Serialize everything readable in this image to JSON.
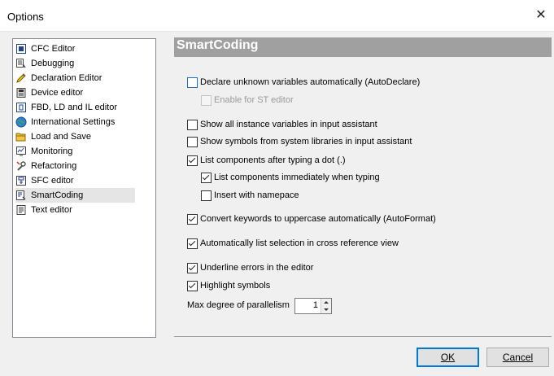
{
  "window": {
    "title": "Options"
  },
  "sidebar": {
    "items": [
      {
        "label": "CFC Editor",
        "icon": "cfc-editor-icon"
      },
      {
        "label": "Debugging",
        "icon": "debugging-icon"
      },
      {
        "label": "Declaration Editor",
        "icon": "declaration-editor-icon"
      },
      {
        "label": "Device editor",
        "icon": "device-editor-icon"
      },
      {
        "label": "FBD, LD and IL editor",
        "icon": "fbd-ld-il-editor-icon"
      },
      {
        "label": "International Settings",
        "icon": "globe-icon"
      },
      {
        "label": "Load and Save",
        "icon": "folder-icon"
      },
      {
        "label": "Monitoring",
        "icon": "monitoring-icon"
      },
      {
        "label": "Refactoring",
        "icon": "refactoring-icon"
      },
      {
        "label": "SFC editor",
        "icon": "sfc-editor-icon"
      },
      {
        "label": "SmartCoding",
        "icon": "smartcoding-icon"
      },
      {
        "label": "Text editor",
        "icon": "text-editor-icon"
      }
    ],
    "selected": "SmartCoding"
  },
  "panel": {
    "title": "SmartCoding",
    "options": {
      "autodeclare": "Declare unknown variables automatically (AutoDeclare)",
      "enable_st": "Enable for ST editor",
      "show_instance_vars": "Show all instance variables in input assistant",
      "show_system_libs": "Show symbols from system libraries in input assistant",
      "list_components_dot": "List components after typing a dot (.)",
      "list_components_immediately": "List components immediately when typing",
      "insert_namespace": "Insert with namepace",
      "convert_keywords": "Convert keywords to uppercase automatically (AutoFormat)",
      "list_cross_reference": "Automatically list selection in cross reference view",
      "underline_errors": "Underline errors in the editor",
      "highlight_symbols": "Highlight symbols"
    },
    "states": {
      "autodeclare": false,
      "enable_st": false,
      "show_instance_vars": false,
      "show_system_libs": false,
      "list_components_dot": true,
      "list_components_immediately": true,
      "insert_namespace": false,
      "convert_keywords": true,
      "list_cross_reference": true,
      "underline_errors": true,
      "highlight_symbols": true
    },
    "parallelism": {
      "label": "Max degree of parallelism",
      "value": "1"
    }
  },
  "footer": {
    "ok_label": "OK",
    "cancel_label": "Cancel"
  },
  "colors": {
    "header_bg": "#a0a0a0",
    "focus_blue": "#0078d7"
  }
}
